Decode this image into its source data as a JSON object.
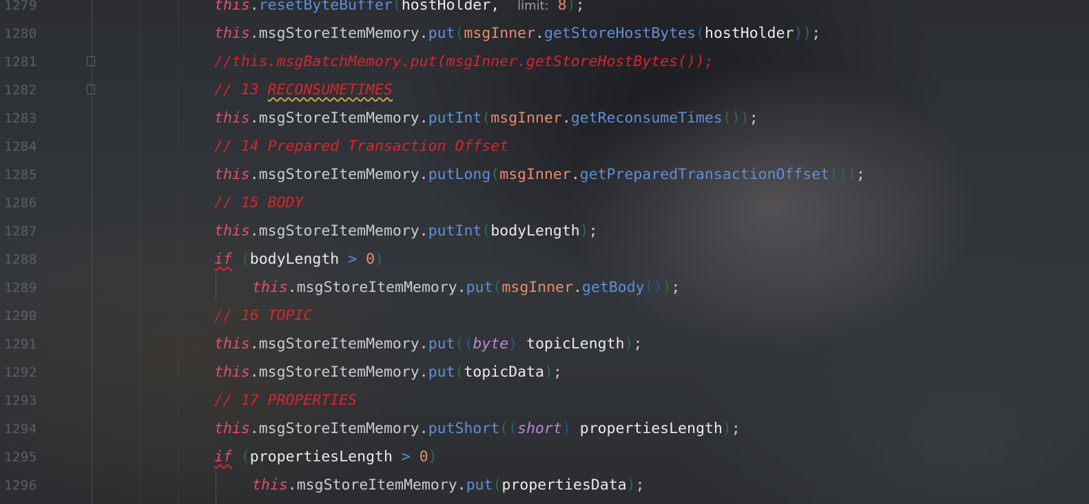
{
  "editor": {
    "colors": {
      "keyword": "#e34f6e",
      "method": "#5f8fd8",
      "parameter": "#e98b6a",
      "comment": "#d8262e",
      "type": "#b88ad6",
      "line_number": "#5c6166"
    },
    "inlay_hint": "limit:",
    "lines": [
      {
        "num": "1279",
        "kw": "this",
        "dot": ".",
        "field": "",
        "method": "resetByteBuffer",
        "arg": "hostHolder",
        "comma": ",",
        "hint_val": "8",
        "end": ";"
      },
      {
        "num": "1280",
        "kw": "this",
        "field": "msgStoreItemMemory",
        "method": "put",
        "param": "msgInner",
        "inner": "getStoreHostBytes",
        "arg": "hostHolder",
        "end": ";"
      },
      {
        "num": "1281",
        "comment": "//this.msgBatchMemory.put(msgInner.getStoreHostBytes());"
      },
      {
        "num": "1282",
        "comment_prefix": "// 13 ",
        "comment_word": "RECONSUMETIMES"
      },
      {
        "num": "1283",
        "kw": "this",
        "field": "msgStoreItemMemory",
        "method": "putInt",
        "param": "msgInner",
        "inner": "getReconsumeTimes",
        "end": ";"
      },
      {
        "num": "1284",
        "comment": "// 14 Prepared Transaction Offset"
      },
      {
        "num": "1285",
        "kw": "this",
        "field": "msgStoreItemMemory",
        "method": "putLong",
        "param": "msgInner",
        "inner": "getPreparedTransactionOffset",
        "end": ";"
      },
      {
        "num": "1286",
        "comment": "// 15 BODY"
      },
      {
        "num": "1287",
        "kw": "this",
        "field": "msgStoreItemMemory",
        "method": "putInt",
        "arg": "bodyLength",
        "end": ";"
      },
      {
        "num": "1288",
        "kw": "if",
        "arg": "bodyLength",
        "op": ">",
        "val": "0"
      },
      {
        "num": "1289",
        "kw": "this",
        "field": "msgStoreItemMemory",
        "method": "put",
        "param": "msgInner",
        "inner": "getBody",
        "end": ";"
      },
      {
        "num": "1290",
        "comment": "// 16 TOPIC"
      },
      {
        "num": "1291",
        "kw": "this",
        "field": "msgStoreItemMemory",
        "method": "put",
        "type": "byte",
        "arg": "topicLength",
        "end": ";"
      },
      {
        "num": "1292",
        "kw": "this",
        "field": "msgStoreItemMemory",
        "method": "put",
        "arg": "topicData",
        "end": ";"
      },
      {
        "num": "1293",
        "comment": "// 17 PROPERTIES"
      },
      {
        "num": "1294",
        "kw": "this",
        "field": "msgStoreItemMemory",
        "method": "putShort",
        "type": "short",
        "arg": "propertiesLength",
        "end": ";"
      },
      {
        "num": "1295",
        "kw": "if",
        "arg": "propertiesLength",
        "op": ">",
        "val": "0"
      },
      {
        "num": "1296",
        "kw": "this",
        "field": "msgStoreItemMemory",
        "method": "put",
        "arg": "propertiesData",
        "end": ";"
      }
    ]
  }
}
